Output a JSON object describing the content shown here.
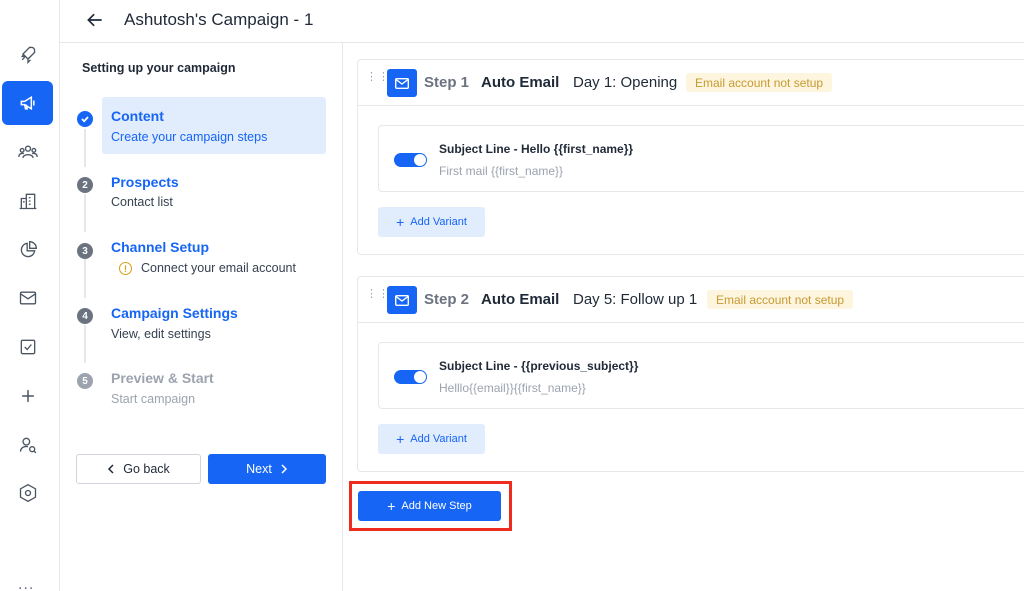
{
  "header": {
    "title": "Ashutosh's Campaign - 1"
  },
  "sidebar": {
    "icons": [
      "rocket-icon",
      "megaphone-icon",
      "users-icon",
      "building-icon",
      "pie-chart-icon",
      "mail-icon",
      "checkbox-icon",
      "plus-icon",
      "user-search-icon",
      "hexagon-settings-icon"
    ],
    "active": "megaphone-icon",
    "more": "..."
  },
  "setup": {
    "title": "Setting up your campaign",
    "steps": [
      {
        "num": "1",
        "label": "Content",
        "sub": "Create your campaign steps",
        "state": "done"
      },
      {
        "num": "2",
        "label": "Prospects",
        "sub": "Contact list",
        "state": "open"
      },
      {
        "num": "3",
        "label": "Channel Setup",
        "sub": "Connect your email account",
        "state": "warning"
      },
      {
        "num": "4",
        "label": "Campaign Settings",
        "sub": "View, edit settings",
        "state": "open"
      },
      {
        "num": "5",
        "label": "Preview & Start",
        "sub": "Start campaign",
        "state": "disabled"
      }
    ],
    "back_label": "Go back",
    "next_label": "Next"
  },
  "sequence": [
    {
      "step": "Step 1",
      "type": "Auto Email",
      "day": "Day 1: Opening",
      "badge": "Email account not setup",
      "subject": "Subject Line - Hello {{first_name}}",
      "preview": "First mail {{first_name}}",
      "enabled": true,
      "add_variant": "Add Variant"
    },
    {
      "step": "Step 2",
      "type": "Auto Email",
      "day": "Day 5: Follow up 1",
      "badge": "Email account not setup",
      "subject": "Subject Line - {{previous_subject}}",
      "preview": "Helllo{{email}}{{first_name}}",
      "enabled": true,
      "add_variant": "Add Variant"
    }
  ],
  "add_step_label": "Add New Step",
  "colors": {
    "primary": "#1665f5",
    "highlight": "#ef2b1e",
    "badge_bg": "#fdf5dd",
    "badge_text": "#c79a33",
    "active_step_bg": "#e1ecfd"
  }
}
